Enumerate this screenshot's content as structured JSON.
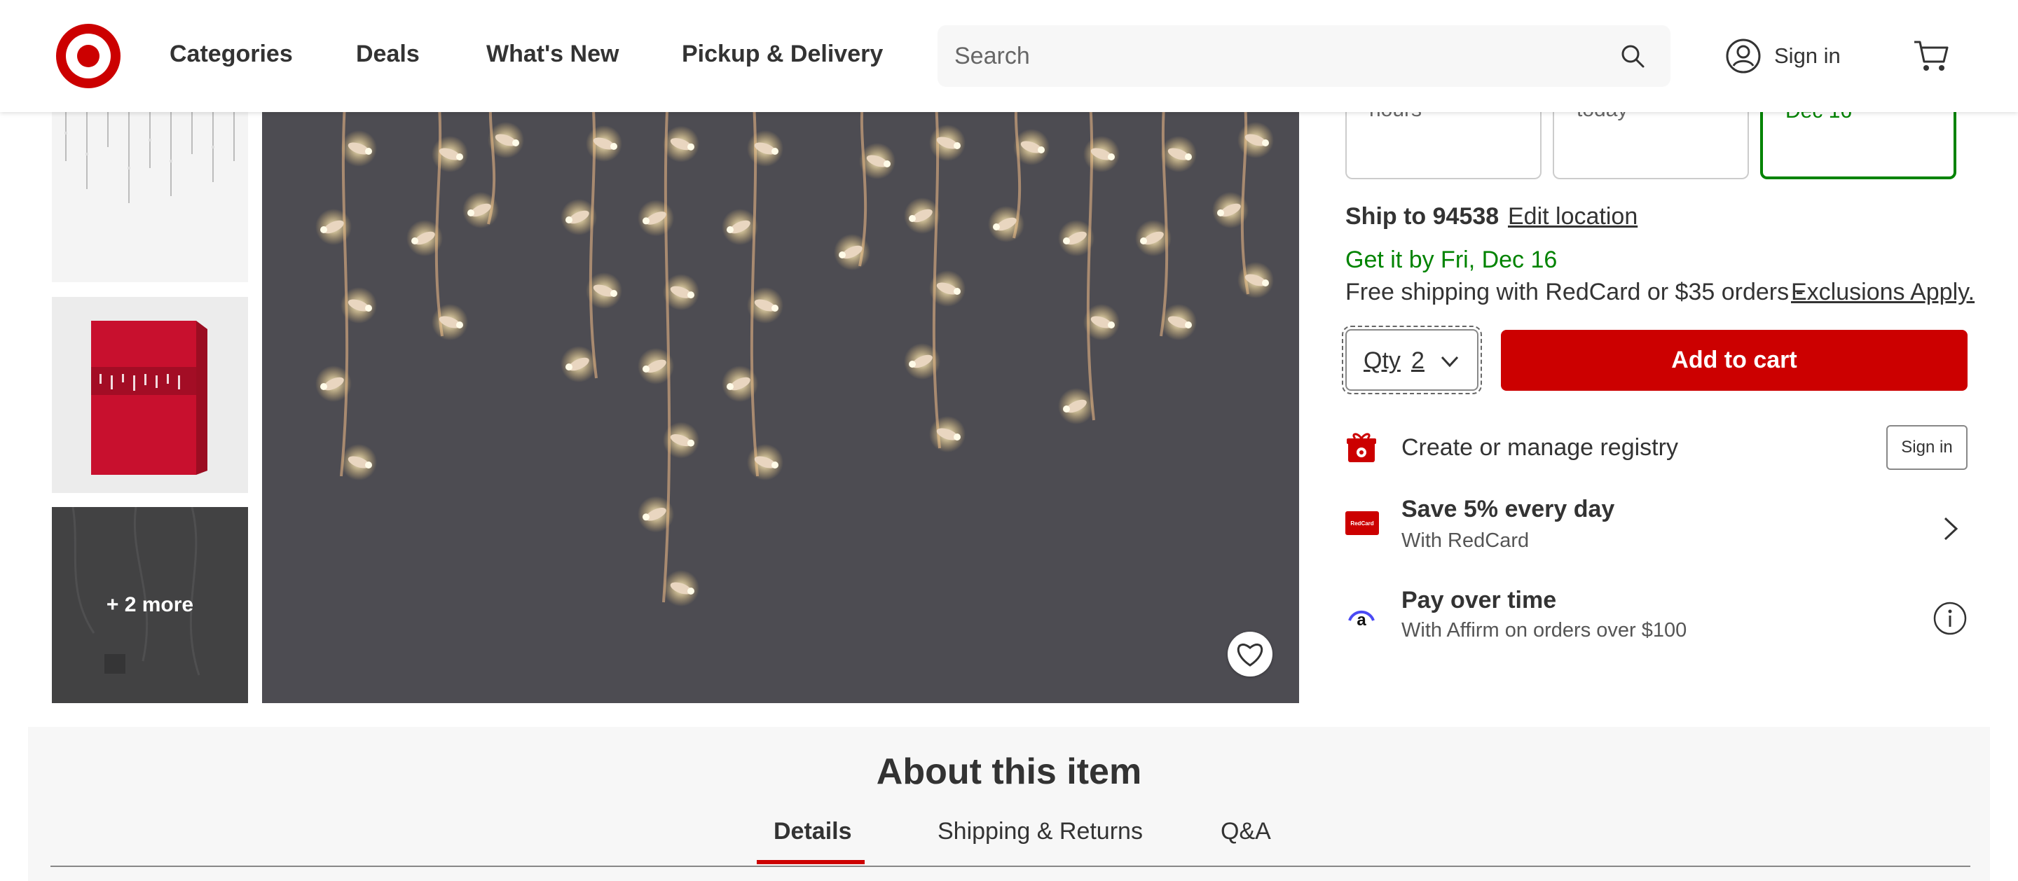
{
  "header": {
    "nav": [
      "Categories",
      "Deals",
      "What's New",
      "Pickup & Delivery"
    ],
    "search_placeholder": "Search",
    "sign_in": "Sign in"
  },
  "gallery": {
    "more_label": "+ 2 more"
  },
  "fulfillment": {
    "cards": [
      "hours",
      "today",
      "Dec 16"
    ],
    "selected_index": 2
  },
  "shipping": {
    "ship_to_label": "Ship to 94538",
    "edit_location": "Edit location",
    "get_it": "Get it by Fri, Dec 16",
    "free_shipping": "Free shipping with RedCard or $35 orders -",
    "exclusions": "Exclusions Apply."
  },
  "purchase": {
    "qty_label": "Qty",
    "qty_value": "2",
    "add_to_cart": "Add to cart"
  },
  "registry": {
    "text": "Create or manage registry",
    "sign_in": "Sign in"
  },
  "redcard": {
    "title": "Save 5% every day",
    "subtitle": "With RedCard",
    "icon_text": "RedCard"
  },
  "affirm": {
    "title": "Pay over time",
    "subtitle": "With Affirm on orders over $100"
  },
  "about": {
    "title": "About this item",
    "tabs": [
      "Details",
      "Shipping & Returns",
      "Q&A"
    ],
    "active_tab": 0
  },
  "colors": {
    "brand_red": "#cc0000",
    "green": "#008300"
  }
}
